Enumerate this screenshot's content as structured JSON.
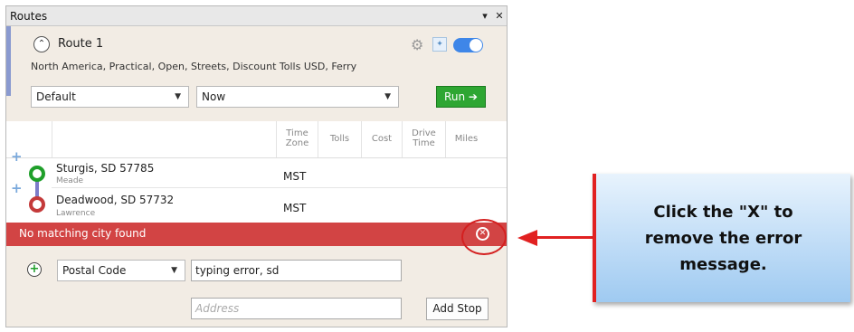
{
  "panel": {
    "title": "Routes",
    "titlebar_dropdown": "▾",
    "titlebar_close": "✕"
  },
  "route": {
    "name": "Route 1",
    "description": "North America, Practical, Open, Streets, Discount Tolls USD, Ferry",
    "profile_select": "Default",
    "time_select": "Now",
    "run_label": "Run ➔",
    "toggle_on": true,
    "accent_color": "#8a9ad0"
  },
  "table": {
    "columns": [
      "Time Zone",
      "Tolls",
      "Cost",
      "Drive Time",
      "Miles"
    ],
    "stops": [
      {
        "name": "Sturgis, SD 57785",
        "county": "Meade",
        "time_zone": "MST"
      },
      {
        "name": "Deadwood, SD 57732",
        "county": "Lawrence",
        "time_zone": "MST"
      }
    ]
  },
  "error": {
    "message": "No matching city found",
    "color": "#d24444"
  },
  "add_stop": {
    "type_select": "Postal Code",
    "city_value": "typing error, sd",
    "address_placeholder": "Address",
    "button_label": "Add Stop"
  },
  "callout": {
    "text": "Click the \"X\" to remove the error message."
  }
}
